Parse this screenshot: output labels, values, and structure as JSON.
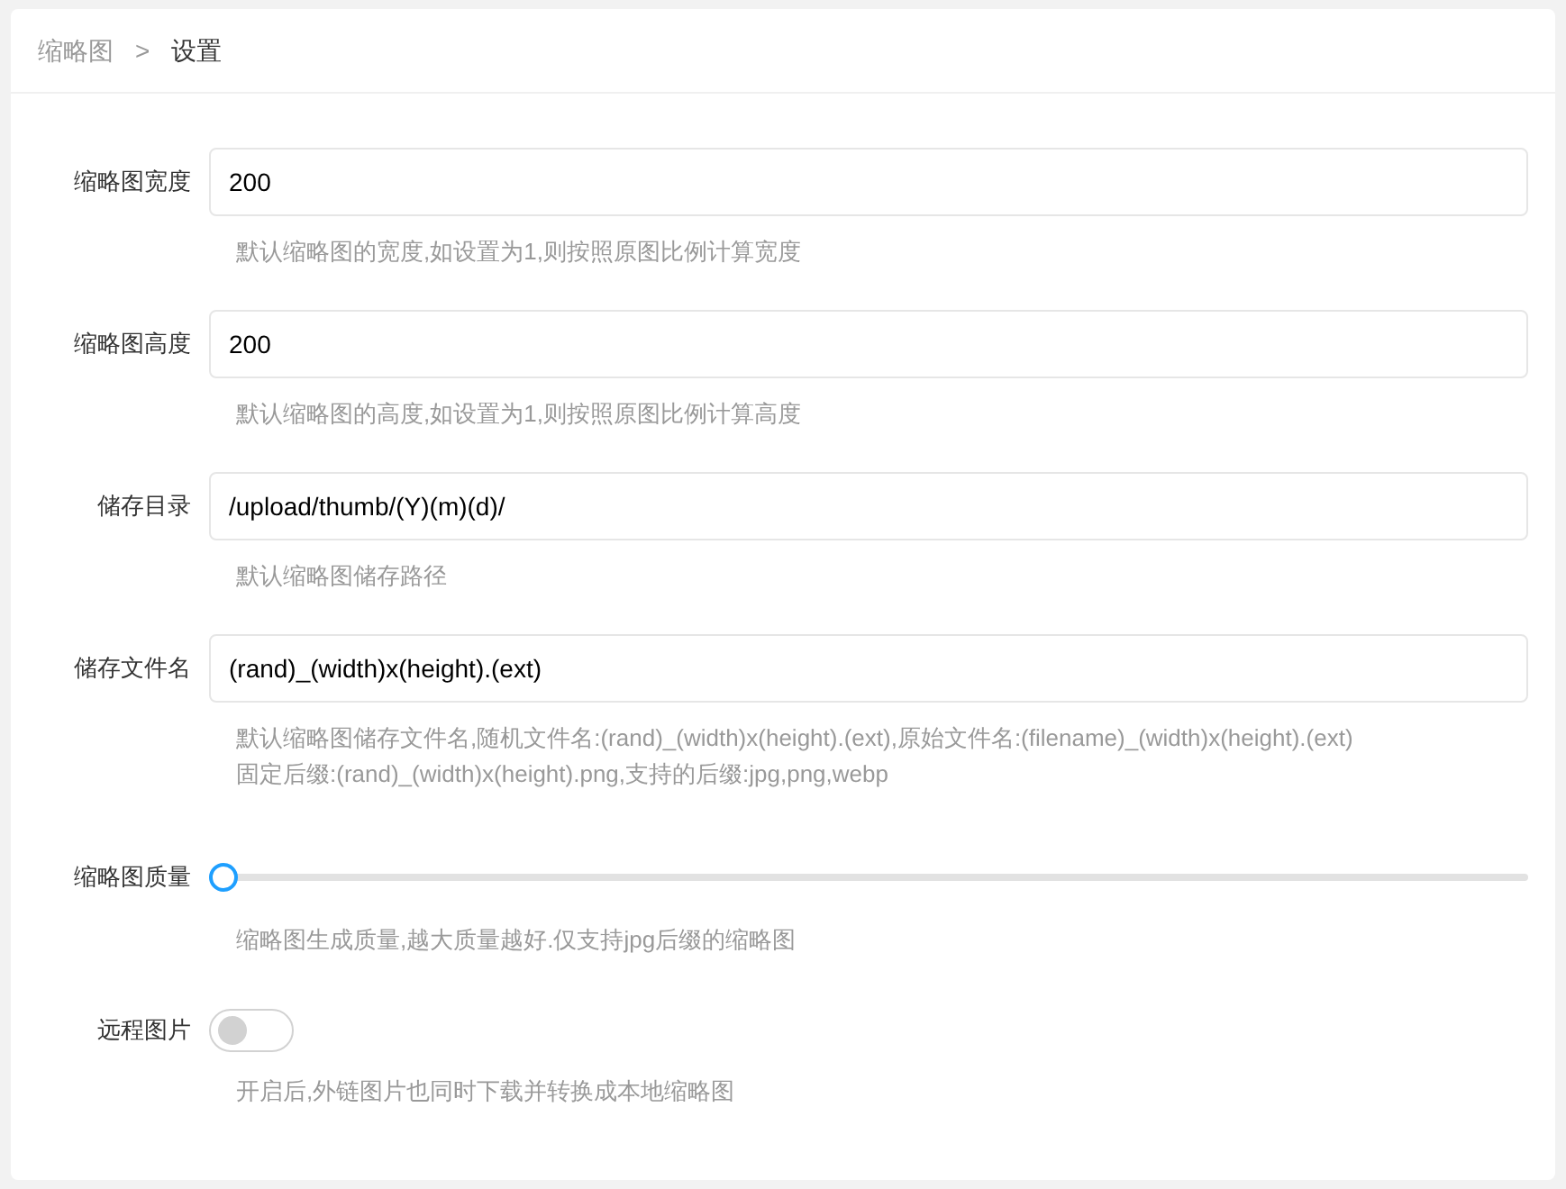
{
  "breadcrumb": [
    {
      "label": "缩略图",
      "current": false
    },
    {
      "label": ">",
      "kind": "separator"
    },
    {
      "label": "设置",
      "current": true
    }
  ],
  "fields": [
    {
      "kind": "text",
      "label": "缩略图宽度",
      "value": "200",
      "help": [
        "默认缩略图的宽度,如设置为1,则按照原图比例计算宽度"
      ]
    },
    {
      "kind": "text",
      "label": "缩略图高度",
      "value": "200",
      "help": [
        "默认缩略图的高度,如设置为1,则按照原图比例计算高度"
      ]
    },
    {
      "kind": "text",
      "label": "储存目录",
      "value": "/upload/thumb/(Y)(m)(d)/",
      "help": [
        "默认缩略图储存路径"
      ]
    },
    {
      "kind": "text",
      "label": "储存文件名",
      "value": "(rand)_(width)x(height).(ext)",
      "help": [
        "默认缩略图储存文件名,随机文件名:(rand)_(width)x(height).(ext),原始文件名:(filename)_(width)x(height).(ext)",
        "固定后缀:(rand)_(width)x(height).png,支持的后缀:jpg,png,webp"
      ]
    },
    {
      "kind": "slider",
      "label": "缩略图质量",
      "level": 0,
      "help": [
        "缩略图生成质量,越大质量越好.仅支持jpg后缀的缩略图"
      ]
    },
    {
      "kind": "switch",
      "label": "远程图片",
      "on": false,
      "help": [
        "开启后,外链图片也同时下载并转换成本地缩略图"
      ]
    }
  ]
}
